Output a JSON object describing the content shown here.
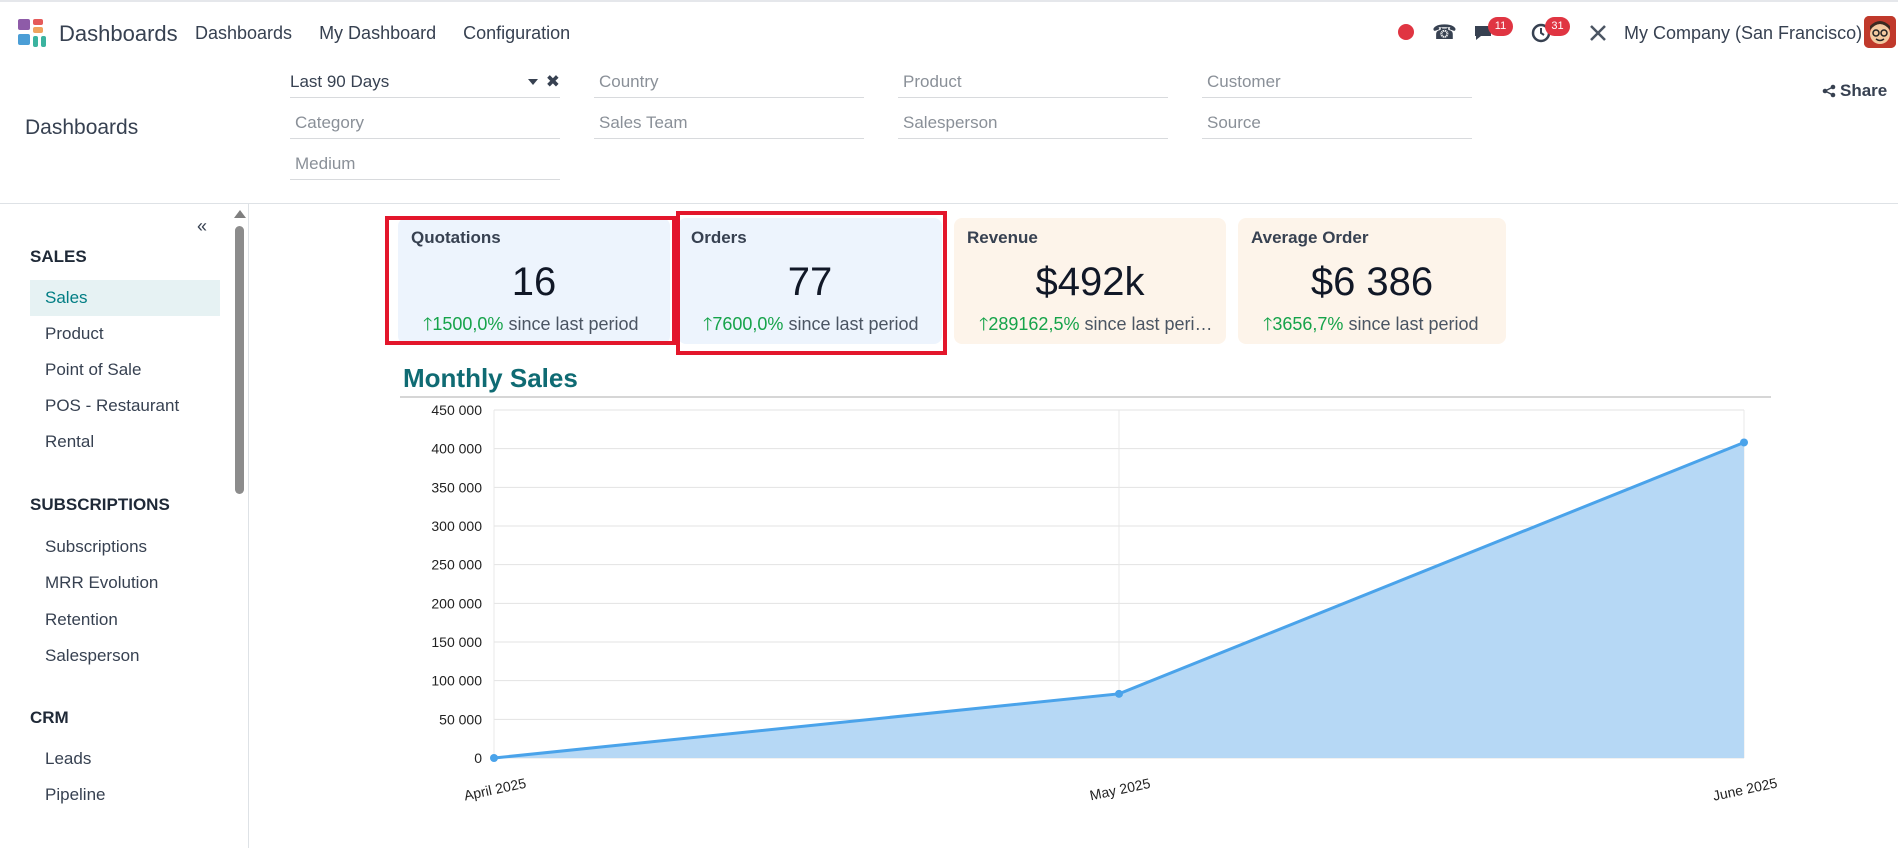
{
  "navbar": {
    "brand": "Dashboards",
    "menu": [
      "Dashboards",
      "My Dashboard",
      "Configuration"
    ],
    "messages_count": "11",
    "activities_count": "31",
    "company": "My Company (San Francisco)"
  },
  "control": {
    "title": "Dashboards",
    "share": "Share",
    "filters": {
      "period": "Last 90 Days",
      "country": "Country",
      "product": "Product",
      "customer": "Customer",
      "category": "Category",
      "sales_team": "Sales Team",
      "salesperson": "Salesperson",
      "source": "Source",
      "medium": "Medium"
    }
  },
  "sidebar": {
    "sections": [
      {
        "title": "SALES",
        "items": [
          "Sales",
          "Product",
          "Point of Sale",
          "POS - Restaurant",
          "Rental"
        ]
      },
      {
        "title": "SUBSCRIPTIONS",
        "items": [
          "Subscriptions",
          "MRR Evolution",
          "Retention",
          "Salesperson"
        ]
      },
      {
        "title": "CRM",
        "items": [
          "Leads",
          "Pipeline"
        ]
      }
    ],
    "active": "Sales"
  },
  "kpis": [
    {
      "title": "Quotations",
      "value": "16",
      "trend": "1500,0%",
      "suffix": " since last period",
      "color": "#edf4fd"
    },
    {
      "title": "Orders",
      "value": "77",
      "trend": "7600,0%",
      "suffix": " since last period",
      "color": "#edf4fd"
    },
    {
      "title": "Revenue",
      "value": "$492k",
      "trend": "289162,5%",
      "suffix": " since last period",
      "color": "#fdf4ea"
    },
    {
      "title": "Average Order",
      "value": "$6 386",
      "trend": "3656,7%",
      "suffix": " since last period",
      "color": "#fdf4ea"
    }
  ],
  "colors": {
    "accent": "#017e84",
    "up": "#16a34a",
    "line": "#4aa3ea",
    "fill": "#b6d8f5",
    "highlight": "#e3162b"
  },
  "chart_data": {
    "type": "area",
    "title": "Monthly Sales",
    "x": [
      "April 2025",
      "May 2025",
      "June 2025"
    ],
    "series": [
      {
        "values": [
          0,
          83000,
          408000
        ]
      }
    ],
    "ylim": [
      0,
      450000
    ],
    "yticks": [
      "0",
      "50 000",
      "100 000",
      "150 000",
      "200 000",
      "250 000",
      "300 000",
      "350 000",
      "400 000",
      "450 000"
    ],
    "grid": true
  }
}
